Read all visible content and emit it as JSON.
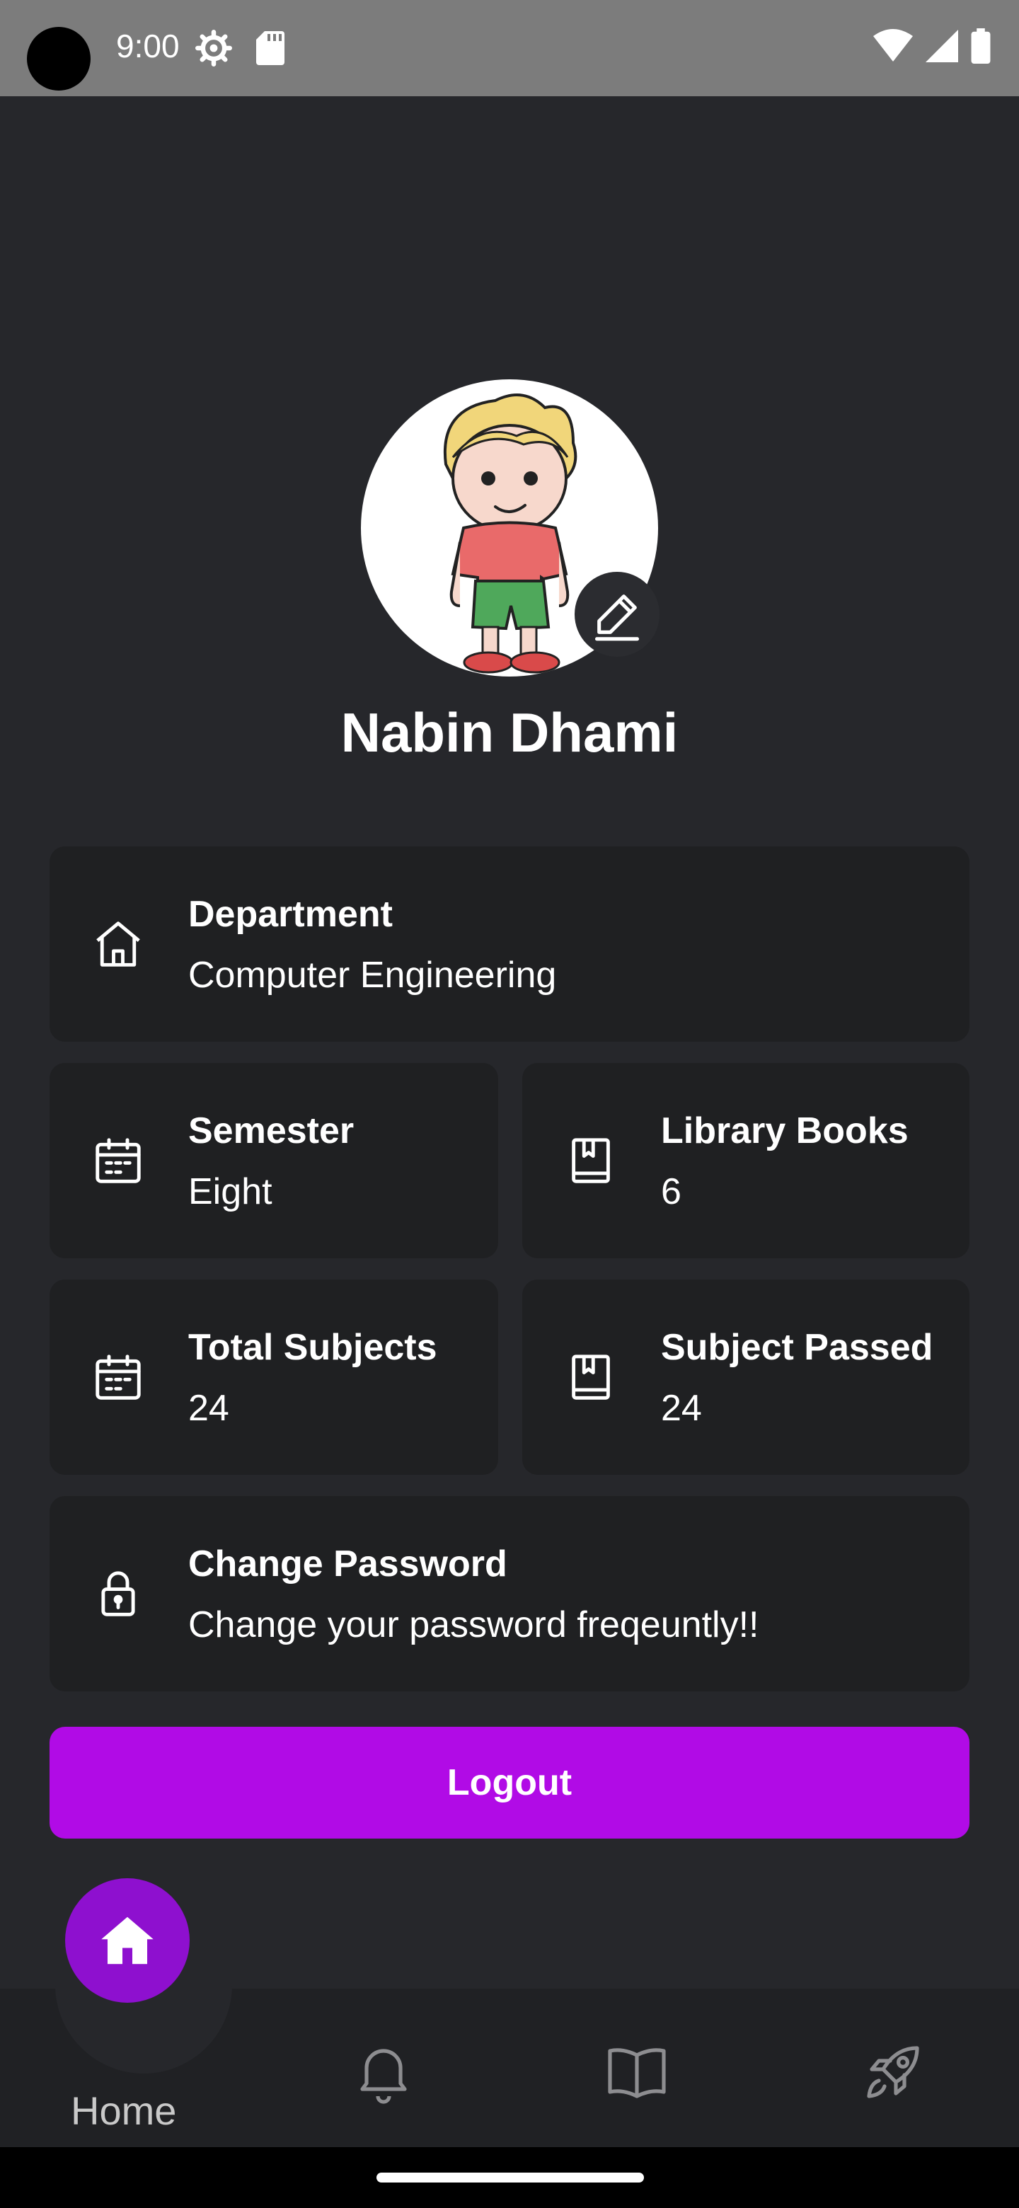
{
  "status_bar": {
    "time": "9:00"
  },
  "profile": {
    "name": "Nabin Dhami"
  },
  "cards": {
    "department": {
      "title": "Department",
      "value": "Computer Engineering"
    },
    "semester": {
      "title": "Semester",
      "value": "Eight"
    },
    "library_books": {
      "title": "Library Books",
      "value": "6"
    },
    "total_subjects": {
      "title": "Total Subjects",
      "value": "24"
    },
    "subject_passed": {
      "title": "Subject Passed",
      "value": "24"
    },
    "change_password": {
      "title": "Change Password",
      "value": "Change your password freqeuntly!!"
    }
  },
  "logout_label": "Logout",
  "nav": {
    "home_label": "Home"
  },
  "colors": {
    "accent": "#b10be6",
    "fab": "#8e10cf",
    "background": "#26272b",
    "card": "#1f2022"
  }
}
